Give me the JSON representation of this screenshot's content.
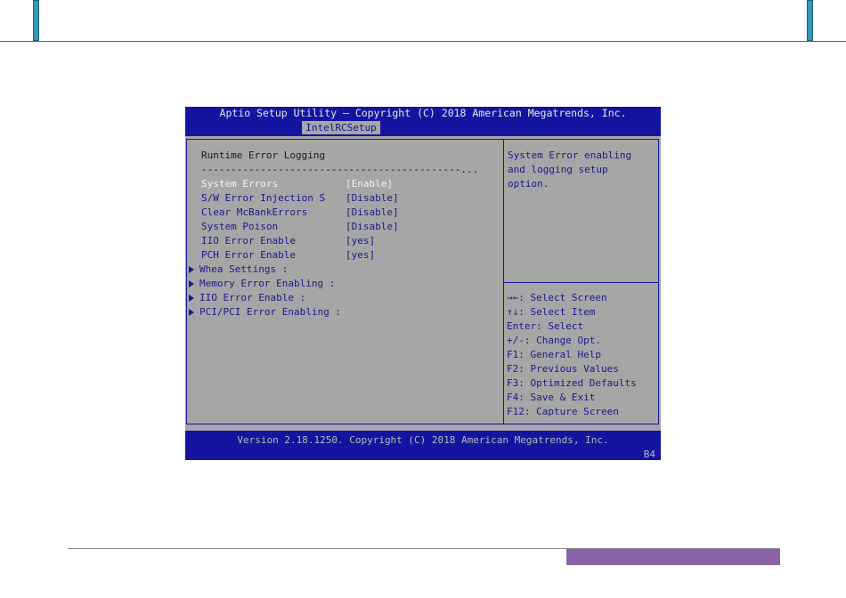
{
  "bios": {
    "title": "Aptio Setup Utility – Copyright (C) 2018 American Megatrends, Inc.",
    "active_tab": "IntelRCSetup",
    "heading": "Runtime Error Logging",
    "separator": "--------------------------------------------...",
    "options": [
      {
        "label": "System Errors",
        "value": "[Enable]",
        "selected": true
      },
      {
        "label": "S/W Error Injection S",
        "value": "[Disable]"
      },
      {
        "label": "Clear McBankErrors",
        "value": "[Disable]"
      },
      {
        "label": "System Poison",
        "value": "[Disable]"
      },
      {
        "label": "IIO Error Enable",
        "value": "[yes]"
      },
      {
        "label": "PCH Error Enable",
        "value": "[yes]"
      }
    ],
    "submenus": [
      "Whea Settings :",
      "Memory Error Enabling :",
      "IIO Error Enable :",
      "PCI/PCI Error Enabling :"
    ],
    "help_text": [
      "System Error enabling",
      "and logging setup",
      "option."
    ],
    "key_help": [
      "→←: Select Screen",
      "↑↓: Select Item",
      "Enter: Select",
      "+/-: Change Opt.",
      "F1: General Help",
      "F2: Previous Values",
      "F3: Optimized Defaults",
      "F4: Save & Exit",
      "F12: Capture Screen"
    ],
    "version": "Version 2.18.1250. Copyright (C) 2018 American Megatrends, Inc.",
    "code": "B4"
  },
  "colors": {
    "bios_blue": "#1414a0",
    "bios_gray": "#a6a6a6",
    "item_blue": "#1a1a8a",
    "header_accent": "#2f9ab9",
    "footer_accent": "#8a63a6"
  }
}
